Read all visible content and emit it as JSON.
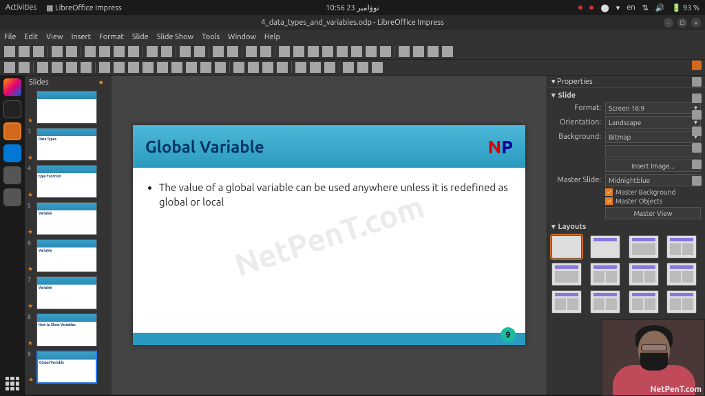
{
  "topbar": {
    "activities": "Activities",
    "appname": "LibreOffice Impress",
    "clock": "10:56 نوۋامبر 23",
    "lang": "en",
    "battery": "93 %"
  },
  "window": {
    "title": "4_data_types_and_variables.odp - LibreOffice Impress"
  },
  "menu": {
    "items": [
      "File",
      "Edit",
      "View",
      "Insert",
      "Format",
      "Slide",
      "Slide Show",
      "Tools",
      "Window",
      "Help"
    ]
  },
  "slidepanel": {
    "title": "Slides",
    "thumbs": [
      {
        "num": "",
        "title": ""
      },
      {
        "num": "3",
        "title": "Data Types"
      },
      {
        "num": "4",
        "title": "type Function"
      },
      {
        "num": "5",
        "title": "Variable"
      },
      {
        "num": "6",
        "title": "Variable"
      },
      {
        "num": "7",
        "title": "Variable"
      },
      {
        "num": "8",
        "title": "How to Show Variables"
      },
      {
        "num": "9",
        "title": "Global Variable"
      }
    ],
    "selected": 7
  },
  "slide": {
    "title": "Global Variable",
    "bullet": "The value of a global variable can be used anywhere unless it is redefined as global or local",
    "watermark": "NetPenT.com",
    "logoN": "N",
    "logoP": "P",
    "page": "9"
  },
  "props": {
    "header": "Properties",
    "slide_section": "Slide",
    "format_label": "Format:",
    "format_value": "Screen 16:9",
    "orientation_label": "Orientation:",
    "orientation_value": "Landscape",
    "background_label": "Background:",
    "background_value": "Bitmap",
    "insert_image": "Insert Image...",
    "master_label": "Master Slide:",
    "master_value": "Midnightblue",
    "chk_bg": "Master Background",
    "chk_obj": "Master Objects",
    "master_view": "Master View",
    "layouts_section": "Layouts"
  },
  "webcam": {
    "watermark": "NetPenT.com"
  }
}
